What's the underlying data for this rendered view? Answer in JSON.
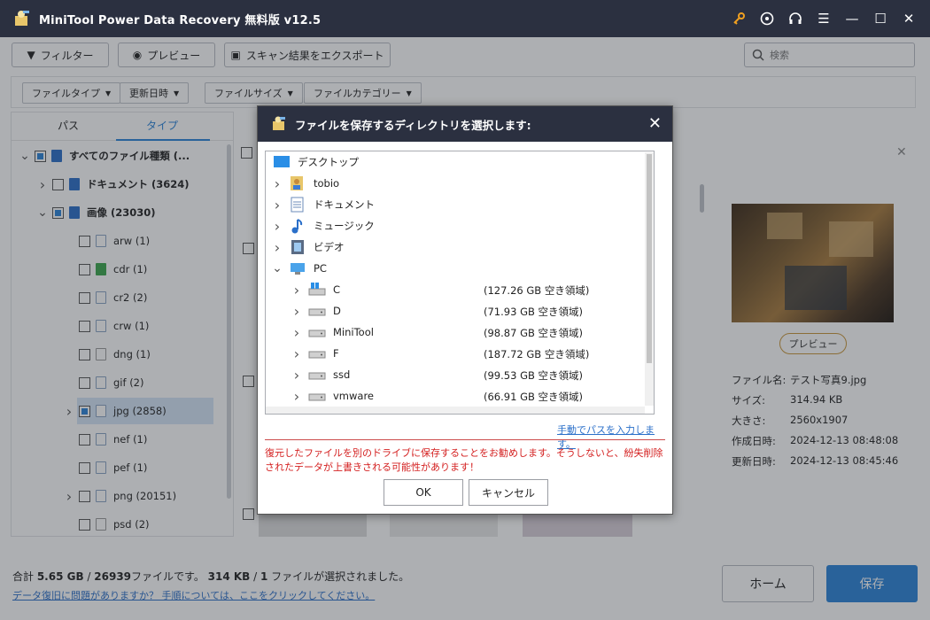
{
  "app": {
    "title": "MiniTool Power Data Recovery 無料版 v12.5"
  },
  "toolbar": {
    "filter_label": "フィルター",
    "preview_label": "プレビュー",
    "export_label": "スキャン結果をエクスポート",
    "search_placeholder": "検索"
  },
  "filters": [
    "ファイルタイプ",
    "更新日時",
    "ファイルサイズ",
    "ファイルカテゴリー"
  ],
  "left_panel": {
    "tabs": [
      "パス",
      "タイプ"
    ],
    "active_tab": "タイプ",
    "tree": [
      {
        "label": "すべてのファイル種類 (...",
        "level": 0,
        "expanded": true,
        "check": "partial",
        "bold": true
      },
      {
        "label": "ドキュメント (3624)",
        "level": 1,
        "expanded": false,
        "check": "none",
        "bold": true
      },
      {
        "label": "画像 (23030)",
        "level": 1,
        "expanded": true,
        "check": "partial",
        "bold": true
      },
      {
        "label": "arw (1)",
        "level": 2,
        "check": "none"
      },
      {
        "label": "cdr (1)",
        "level": 2,
        "check": "none"
      },
      {
        "label": "cr2 (2)",
        "level": 2,
        "check": "none"
      },
      {
        "label": "crw (1)",
        "level": 2,
        "check": "none"
      },
      {
        "label": "dng (1)",
        "level": 2,
        "check": "none"
      },
      {
        "label": "gif (2)",
        "level": 2,
        "check": "none"
      },
      {
        "label": "jpg (2858)",
        "level": 2,
        "expandable": true,
        "check": "partial",
        "selected": true
      },
      {
        "label": "nef (1)",
        "level": 2,
        "check": "none"
      },
      {
        "label": "pef (1)",
        "level": 2,
        "check": "none"
      },
      {
        "label": "png (20151)",
        "level": 2,
        "expandable": true,
        "check": "none"
      },
      {
        "label": "psd (2)",
        "level": 2,
        "check": "none"
      }
    ]
  },
  "preview_panel": {
    "preview_button": "プレビュー",
    "info": [
      {
        "key": "ファイル名:",
        "value": "テスト写真9.jpg"
      },
      {
        "key": "サイズ:",
        "value": "314.94 KB"
      },
      {
        "key": "大きさ:",
        "value": "2560x1907"
      },
      {
        "key": "作成日時:",
        "value": "2024-12-13 08:48:08"
      },
      {
        "key": "更新日時:",
        "value": "2024-12-13 08:45:46"
      }
    ]
  },
  "footer": {
    "summary_prefix": "合計 ",
    "total_size": "5.65 GB",
    "sep1": " / ",
    "total_files": "26939",
    "summary_mid": "ファイルです。 ",
    "sel_size": "314 KB",
    "sep2": " / ",
    "sel_count": "1",
    "summary_end": " ファイルが選択されました。",
    "help_link": "データ復旧に問題がありますか？ 手順については、ここをクリックしてください。",
    "home_label": "ホーム",
    "save_label": "保存"
  },
  "dialog": {
    "title": "ファイルを保存するディレクトリを選択します:",
    "items": [
      {
        "label": "デスクトップ",
        "level": 0,
        "icon": "desktop-icon",
        "chevron": "none"
      },
      {
        "label": "tobio",
        "level": 0,
        "icon": "user-folder-icon",
        "chevron": "right"
      },
      {
        "label": "ドキュメント",
        "level": 0,
        "icon": "documents-icon",
        "chevron": "right"
      },
      {
        "label": "ミュージック",
        "level": 0,
        "icon": "music-icon",
        "chevron": "right"
      },
      {
        "label": "ビデオ",
        "level": 0,
        "icon": "video-icon",
        "chevron": "right"
      },
      {
        "label": "PC",
        "level": 0,
        "icon": "pc-icon",
        "chevron": "down"
      },
      {
        "label": "C",
        "level": 1,
        "icon": "windows-drive-icon",
        "chevron": "right",
        "free": "(127.26 GB 空き領域)"
      },
      {
        "label": "D",
        "level": 1,
        "icon": "drive-icon",
        "chevron": "right",
        "free": "(71.93 GB 空き領域)"
      },
      {
        "label": "MiniTool",
        "level": 1,
        "icon": "drive-icon",
        "chevron": "right",
        "free": "(98.87 GB 空き領域)"
      },
      {
        "label": "F",
        "level": 1,
        "icon": "drive-icon",
        "chevron": "right",
        "free": "(187.72 GB 空き領域)"
      },
      {
        "label": "ssd",
        "level": 1,
        "icon": "drive-icon",
        "chevron": "right",
        "free": "(99.53 GB 空き領域)"
      },
      {
        "label": "vmware",
        "level": 1,
        "icon": "drive-icon",
        "chevron": "right",
        "free": "(66.91 GB 空き領域)"
      }
    ],
    "manual_link": "手動でパスを入力します。",
    "warning": "復元したファイルを別のドライブに保存することをお勧めします。そうしないと、紛失削除されたデータが上書きされる可能性があります！",
    "ok_label": "OK",
    "cancel_label": "キャンセル"
  },
  "colors": {
    "titlebar": "#2b3040",
    "accent": "#2a83d8",
    "warning": "#d42020"
  }
}
